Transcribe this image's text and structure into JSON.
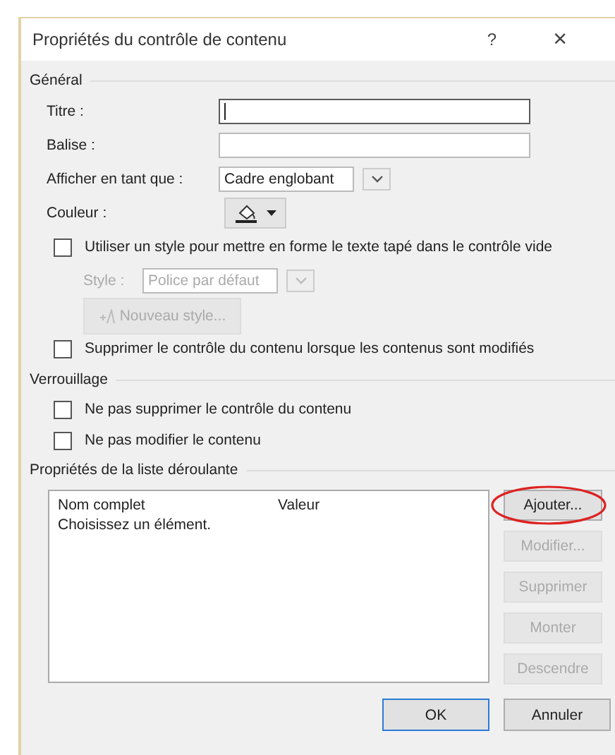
{
  "window": {
    "title": "Propriétés du contrôle de contenu",
    "help": "?",
    "close": "×"
  },
  "general": {
    "heading": "Général",
    "fields": [
      {
        "kind": "text",
        "label": "Titre :",
        "focused": true
      },
      {
        "kind": "text",
        "label": "Balise :",
        "focused": false
      },
      {
        "kind": "select",
        "label": "Afficher en tant que :",
        "value": "Cadre englobant"
      },
      {
        "kind": "color",
        "label": "Couleur :"
      }
    ],
    "use_style": {
      "label": "Utiliser un style pour mettre en forme le texte tapé dans le contrôle vide",
      "checked": false
    },
    "style": {
      "label": "Style :",
      "value": "Police par défaut",
      "disabled": true
    },
    "new_style": {
      "label": "Nouveau style...",
      "disabled": true
    },
    "remove_on_edit": {
      "label": "Supprimer le contrôle du contenu lorsque les contenus sont modifiés",
      "checked": false
    }
  },
  "locking": {
    "heading": "Verrouillage",
    "options": [
      {
        "label": "Ne pas supprimer le contrôle du contenu",
        "checked": false
      },
      {
        "label": "Ne pas modifier le contenu",
        "checked": false
      }
    ]
  },
  "dropdown": {
    "heading": "Propriétés de la liste déroulante",
    "columns": [
      "Nom complet",
      "Valeur"
    ],
    "rows": [
      {
        "name": "Choisissez un élément."
      }
    ],
    "buttons": [
      {
        "label": "Ajouter...",
        "disabled": false,
        "highlighted": true
      },
      {
        "label": "Modifier...",
        "disabled": true,
        "highlighted": false
      },
      {
        "label": "Supprimer",
        "disabled": true,
        "highlighted": false
      },
      {
        "label": "Monter",
        "disabled": true,
        "highlighted": false
      },
      {
        "label": "Descendre",
        "disabled": true,
        "highlighted": false
      }
    ]
  },
  "footer": {
    "buttons": [
      {
        "label": "OK",
        "default": true
      },
      {
        "label": "Annuler",
        "default": false
      }
    ]
  }
}
